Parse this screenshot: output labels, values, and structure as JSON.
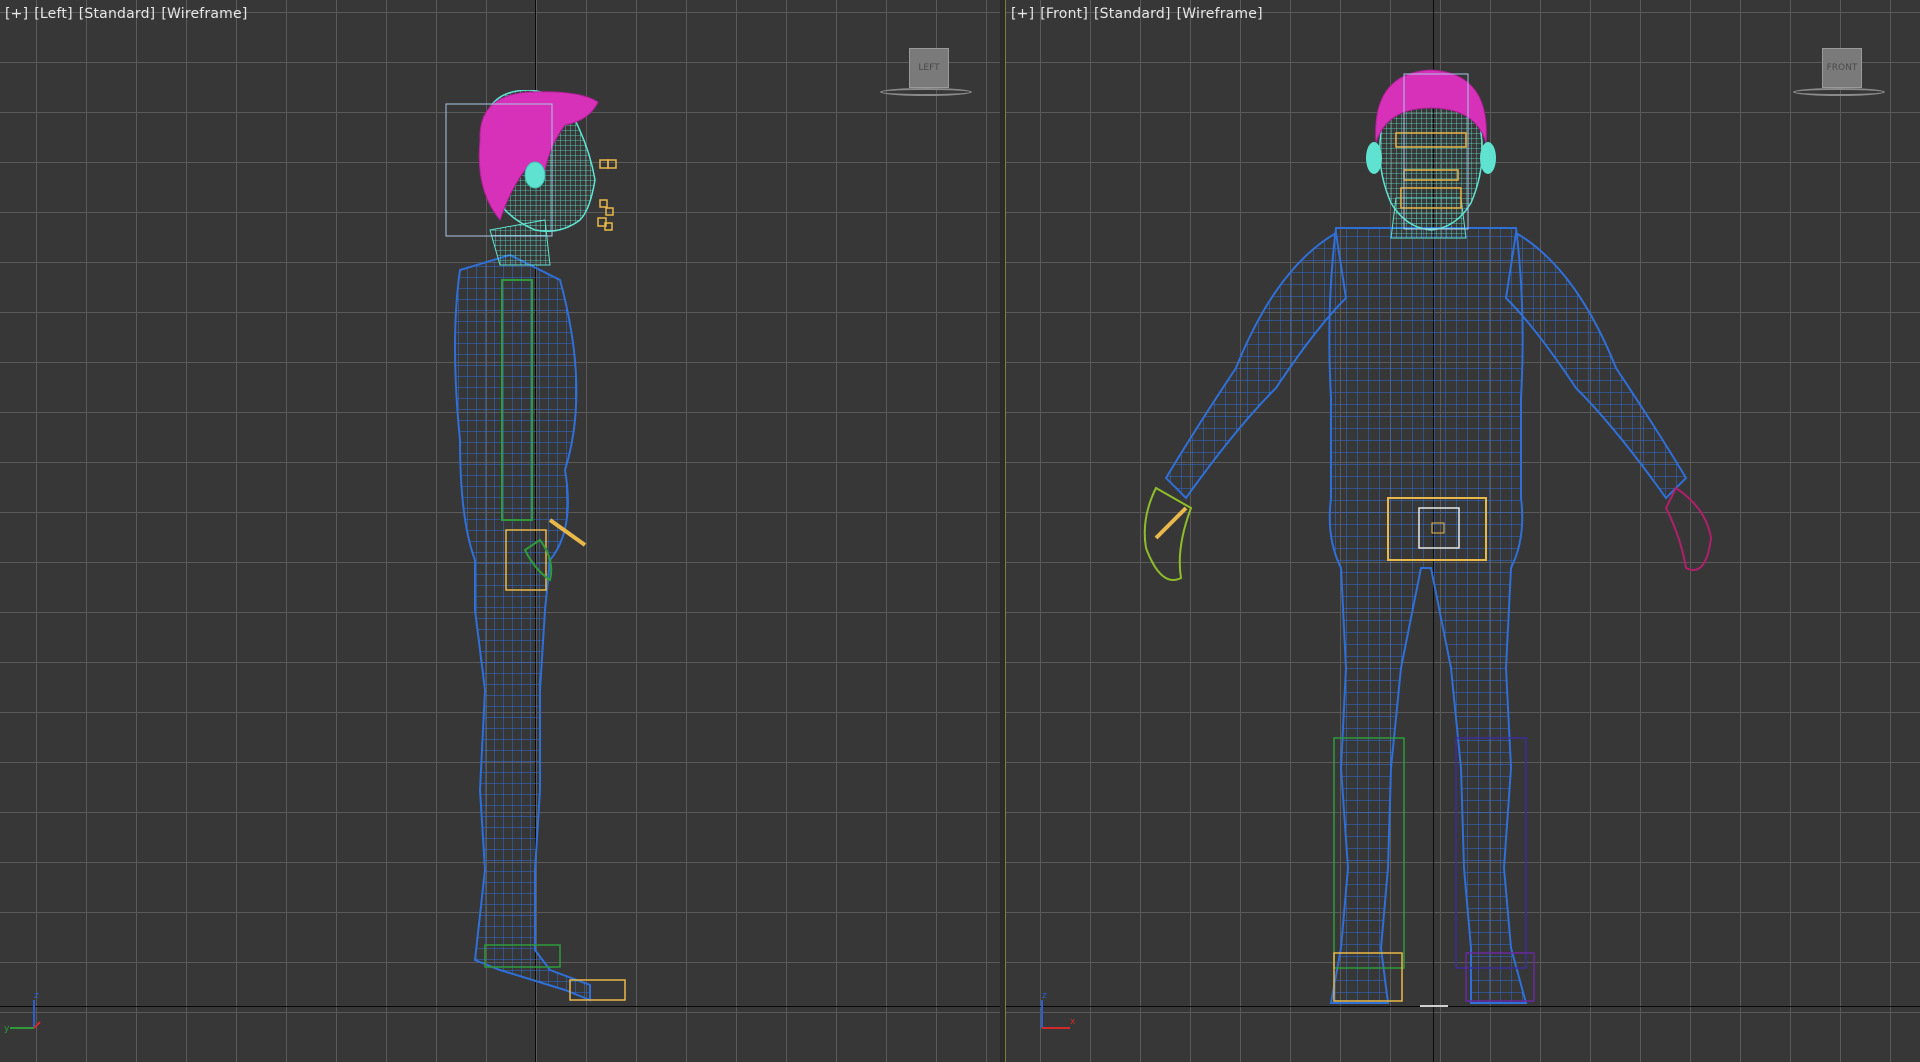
{
  "viewports": {
    "left": {
      "menu": "[+]",
      "view": "[Left]",
      "shading": "[Standard]",
      "mode": "[Wireframe]",
      "viewcube_label": "LEFT"
    },
    "front": {
      "menu": "[+]",
      "view": "[Front]",
      "shading": "[Standard]",
      "mode": "[Wireframe]",
      "viewcube_label": "FRONT"
    }
  },
  "gizmo": {
    "z": "z",
    "y": "y",
    "x": "x"
  },
  "colors": {
    "background": "#373737",
    "grid": "#5a5a5a",
    "mesh": "#2f6fd6",
    "bones": "#2e9a3a",
    "hair": "#d631b8",
    "face": "#5fe3d0",
    "rig": "#e8b84a"
  }
}
